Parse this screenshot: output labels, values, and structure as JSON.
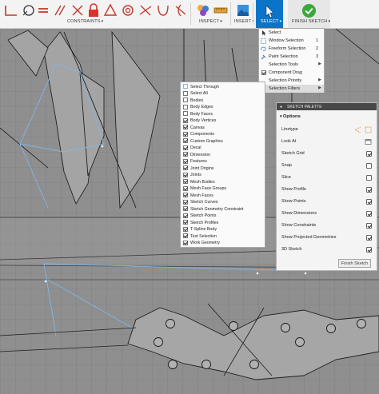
{
  "toolbar": {
    "groups": {
      "constraints": "CONSTRAINTS",
      "inspect": "INSPECT",
      "insert": "INSERT",
      "select": "SELECT",
      "finish_sketch": "FINISH SKETCH"
    }
  },
  "select_menu": {
    "items": [
      {
        "label": "Select",
        "shortcut": ""
      },
      {
        "label": "Window Selection",
        "shortcut": "1"
      },
      {
        "label": "Freeform Selection",
        "shortcut": "2"
      },
      {
        "label": "Paint Selection",
        "shortcut": "3"
      },
      {
        "label": "Selection Tools",
        "shortcut": ""
      },
      {
        "label": "Component Drag",
        "shortcut": ""
      },
      {
        "label": "Selection Priority",
        "shortcut": ""
      },
      {
        "label": "Selection Filters",
        "shortcut": ""
      }
    ]
  },
  "filters_menu": {
    "items": [
      {
        "label": "Select Through",
        "checked": false
      },
      {
        "label": "Select All",
        "checked": false
      },
      {
        "label": "Bodies",
        "checked": false
      },
      {
        "label": "Body Edges",
        "checked": false
      },
      {
        "label": "Body Faces",
        "checked": false
      },
      {
        "label": "Body Vertices",
        "checked": true
      },
      {
        "label": "Canvas",
        "checked": true
      },
      {
        "label": "Components",
        "checked": true
      },
      {
        "label": "Custom Graphics",
        "checked": true
      },
      {
        "label": "Decal",
        "checked": true
      },
      {
        "label": "Dimension",
        "checked": true
      },
      {
        "label": "Features",
        "checked": true
      },
      {
        "label": "Joint Origins",
        "checked": true
      },
      {
        "label": "Joints",
        "checked": true
      },
      {
        "label": "Mesh Bodies",
        "checked": true
      },
      {
        "label": "Mesh Face Groups",
        "checked": true
      },
      {
        "label": "Mesh Faces",
        "checked": true
      },
      {
        "label": "Sketch Curves",
        "checked": true
      },
      {
        "label": "Sketch Geometry Constraint",
        "checked": true
      },
      {
        "label": "Sketch Points",
        "checked": true
      },
      {
        "label": "Sketch Profiles",
        "checked": true
      },
      {
        "label": "T-Spline Body",
        "checked": true
      },
      {
        "label": "Text Selection",
        "checked": true
      },
      {
        "label": "Work Geometry",
        "checked": true
      }
    ]
  },
  "palette": {
    "title": "SKETCH PALETTE",
    "section": "Options",
    "rows": [
      {
        "label": "Linetype",
        "control": "linetype"
      },
      {
        "label": "Look At",
        "control": "lookat"
      },
      {
        "label": "Sketch Grid",
        "control": "checkbox",
        "checked": true
      },
      {
        "label": "Snap",
        "control": "checkbox",
        "checked": false
      },
      {
        "label": "Slice",
        "control": "checkbox",
        "checked": false
      },
      {
        "label": "Show Profile",
        "control": "checkbox",
        "checked": true
      },
      {
        "label": "Show Points",
        "control": "checkbox",
        "checked": true
      },
      {
        "label": "Show Dimensions",
        "control": "checkbox",
        "checked": true
      },
      {
        "label": "Show Constraints",
        "control": "checkbox",
        "checked": true
      },
      {
        "label": "Show Projected Geometries",
        "control": "checkbox",
        "checked": true
      },
      {
        "label": "3D Sketch",
        "control": "checkbox",
        "checked": true
      }
    ],
    "finish_label": "Finish Sketch"
  },
  "colors": {
    "select_active": "#0a75c8",
    "finish_green": "#3aa83a",
    "sketch_line": "#7fb7ea",
    "canvas_grid": "#8e8e8e"
  }
}
